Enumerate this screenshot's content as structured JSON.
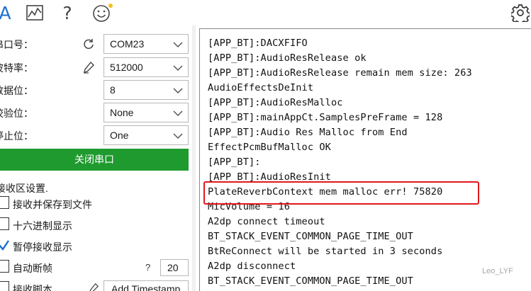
{
  "toolbar": {
    "tab_a_label": "A",
    "help_label": "?",
    "icons": [
      "chart-icon",
      "smiley-icon",
      "gear-icon"
    ]
  },
  "settings": {
    "port": {
      "label": "串口号：",
      "value": "COM23",
      "icon": "refresh-icon"
    },
    "baud": {
      "label": "波特率：",
      "value": "512000",
      "icon": "pen-icon"
    },
    "databits": {
      "label": "数据位：",
      "value": "8"
    },
    "parity": {
      "label": "校验位：",
      "value": "None"
    },
    "stopbits": {
      "label": "停止位：",
      "value": "One"
    },
    "close_button": "关闭串口"
  },
  "receive": {
    "section_title": "接收区设置.",
    "options": [
      {
        "label": "接收并保存到文件",
        "checked": false
      },
      {
        "label": "十六进制显示",
        "checked": false
      },
      {
        "label": "暂停接收显示",
        "checked": true
      },
      {
        "label": "自动断帧",
        "checked": false
      },
      {
        "label": "接收脚本",
        "checked": false
      }
    ],
    "frame_help": "?",
    "frame_value": "20",
    "script_value": "Add Timestamp"
  },
  "log": {
    "lines": [
      "[APP_BT]:DACXFIFO",
      "[APP_BT]:AudioResRelease ok",
      "[APP_BT]:AudioResRelease remain mem size: 263",
      "AudioEffectsDeInit",
      "[APP_BT]:AudioResMalloc",
      "[APP_BT]:mainAppCt.SamplesPreFrame = 128",
      "[APP_BT]:Audio Res Malloc from End",
      "EffectPcmBufMalloc OK",
      "[APP_BT]:",
      "[APP_BT]:AudioResInit",
      "PlateReverbContext mem malloc err! 75820",
      "MicVolume = 16",
      "A2dp connect timeout",
      "BT_STACK_EVENT_COMMON_PAGE_TIME_OUT",
      "BtReConnect will be started in 3 seconds",
      "A2dp disconnect",
      "BT_STACK_EVENT_COMMON_PAGE_TIME_OUT"
    ],
    "highlight_color": "#e0181c"
  },
  "watermark": "Leo_LYF",
  "colors": {
    "accent_green": "#1f9a2f",
    "accent_blue": "#1a6fd4"
  }
}
